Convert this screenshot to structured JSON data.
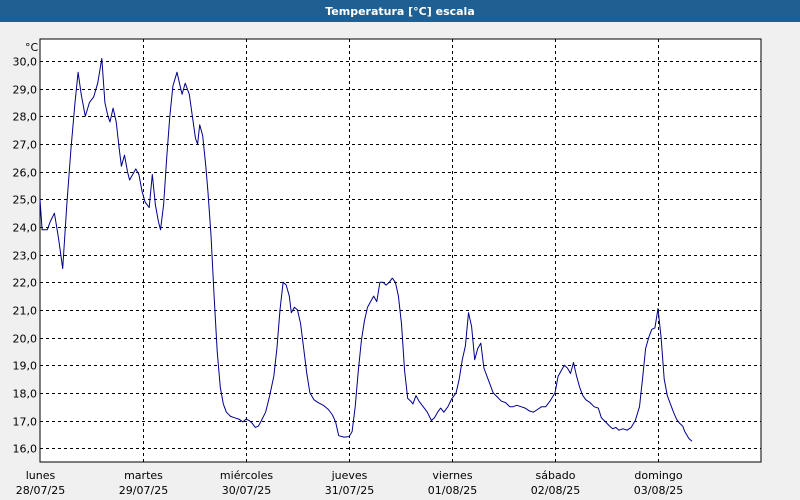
{
  "window": {
    "title": "Temperatura [°C] escala"
  },
  "colors": {
    "title_bar": "#1f5f91",
    "line": "#00008b",
    "grid": "#000000",
    "plot_bg": "#ffffff",
    "page_bg": "#f0f0f0"
  },
  "chart_data": {
    "type": "line",
    "title": "Temperatura [°C] escala",
    "ylabel": "°C",
    "xlabel": "",
    "ylim": [
      15.5,
      30.8
    ],
    "xlim": [
      0,
      7
    ],
    "yticks": [
      16,
      17,
      18,
      19,
      20,
      21,
      22,
      23,
      24,
      25,
      26,
      27,
      28,
      29,
      30
    ],
    "ytick_labels": [
      "16,0",
      "17,0",
      "18,0",
      "19,0",
      "20,0",
      "21,0",
      "22,0",
      "23,0",
      "24,0",
      "25,0",
      "26,0",
      "27,0",
      "28,0",
      "29,0",
      "30,0"
    ],
    "x_day_labels": [
      {
        "day": "lunes",
        "date": "28/07/25"
      },
      {
        "day": "martes",
        "date": "29/07/25"
      },
      {
        "day": "miércoles",
        "date": "30/07/25"
      },
      {
        "day": "jueves",
        "date": "31/07/25"
      },
      {
        "day": "viernes",
        "date": "01/08/25"
      },
      {
        "day": "sábado",
        "date": "02/08/25"
      },
      {
        "day": "domingo",
        "date": "03/08/25"
      }
    ],
    "grid": true,
    "series": [
      {
        "values": [
          [
            0.0,
            25.0
          ],
          [
            0.02,
            23.9
          ],
          [
            0.07,
            23.9
          ],
          [
            0.1,
            24.2
          ],
          [
            0.14,
            24.5
          ],
          [
            0.18,
            23.6
          ],
          [
            0.22,
            22.5
          ],
          [
            0.26,
            24.8
          ],
          [
            0.3,
            26.8
          ],
          [
            0.34,
            28.5
          ],
          [
            0.37,
            29.6
          ],
          [
            0.4,
            28.8
          ],
          [
            0.44,
            28.0
          ],
          [
            0.48,
            28.5
          ],
          [
            0.52,
            28.7
          ],
          [
            0.56,
            29.2
          ],
          [
            0.6,
            30.1
          ],
          [
            0.63,
            28.5
          ],
          [
            0.66,
            28.0
          ],
          [
            0.68,
            27.8
          ],
          [
            0.71,
            28.3
          ],
          [
            0.74,
            27.8
          ],
          [
            0.77,
            26.8
          ],
          [
            0.79,
            26.2
          ],
          [
            0.82,
            26.6
          ],
          [
            0.85,
            26.0
          ],
          [
            0.87,
            25.7
          ],
          [
            0.9,
            25.9
          ],
          [
            0.93,
            26.1
          ],
          [
            0.96,
            25.9
          ],
          [
            0.99,
            25.3
          ],
          [
            1.02,
            24.9
          ],
          [
            1.06,
            24.7
          ],
          [
            1.09,
            25.9
          ],
          [
            1.12,
            24.8
          ],
          [
            1.15,
            24.2
          ],
          [
            1.17,
            23.9
          ],
          [
            1.2,
            24.8
          ],
          [
            1.23,
            26.5
          ],
          [
            1.26,
            28.0
          ],
          [
            1.29,
            29.1
          ],
          [
            1.33,
            29.6
          ],
          [
            1.36,
            29.1
          ],
          [
            1.38,
            28.8
          ],
          [
            1.41,
            29.2
          ],
          [
            1.45,
            28.8
          ],
          [
            1.48,
            28.0
          ],
          [
            1.51,
            27.2
          ],
          [
            1.53,
            27.0
          ],
          [
            1.55,
            27.7
          ],
          [
            1.58,
            27.3
          ],
          [
            1.61,
            26.2
          ],
          [
            1.63,
            25.3
          ],
          [
            1.66,
            23.7
          ],
          [
            1.69,
            21.5
          ],
          [
            1.72,
            19.5
          ],
          [
            1.75,
            18.2
          ],
          [
            1.78,
            17.6
          ],
          [
            1.81,
            17.3
          ],
          [
            1.85,
            17.15
          ],
          [
            1.89,
            17.1
          ],
          [
            1.93,
            17.05
          ],
          [
            1.97,
            16.95
          ],
          [
            2.0,
            17.05
          ],
          [
            2.03,
            17.0
          ],
          [
            2.06,
            16.9
          ],
          [
            2.09,
            16.75
          ],
          [
            2.12,
            16.8
          ],
          [
            2.15,
            17.0
          ],
          [
            2.19,
            17.3
          ],
          [
            2.23,
            17.9
          ],
          [
            2.27,
            18.6
          ],
          [
            2.3,
            19.6
          ],
          [
            2.33,
            21.0
          ],
          [
            2.36,
            22.0
          ],
          [
            2.39,
            21.9
          ],
          [
            2.42,
            21.5
          ],
          [
            2.44,
            20.9
          ],
          [
            2.47,
            21.1
          ],
          [
            2.5,
            21.0
          ],
          [
            2.53,
            20.5
          ],
          [
            2.56,
            19.6
          ],
          [
            2.59,
            18.7
          ],
          [
            2.62,
            18.0
          ],
          [
            2.66,
            17.75
          ],
          [
            2.7,
            17.65
          ],
          [
            2.75,
            17.55
          ],
          [
            2.8,
            17.4
          ],
          [
            2.84,
            17.2
          ],
          [
            2.87,
            16.95
          ],
          [
            2.9,
            16.45
          ],
          [
            2.95,
            16.4
          ],
          [
            3.0,
            16.42
          ],
          [
            3.03,
            16.6
          ],
          [
            3.06,
            17.5
          ],
          [
            3.09,
            18.8
          ],
          [
            3.12,
            19.9
          ],
          [
            3.15,
            20.6
          ],
          [
            3.18,
            21.1
          ],
          [
            3.21,
            21.3
          ],
          [
            3.24,
            21.5
          ],
          [
            3.27,
            21.3
          ],
          [
            3.3,
            22.0
          ],
          [
            3.33,
            22.0
          ],
          [
            3.36,
            21.9
          ],
          [
            3.39,
            22.0
          ],
          [
            3.42,
            22.15
          ],
          [
            3.45,
            22.0
          ],
          [
            3.48,
            21.5
          ],
          [
            3.51,
            20.5
          ],
          [
            3.54,
            18.8
          ],
          [
            3.57,
            17.8
          ],
          [
            3.6,
            17.7
          ],
          [
            3.62,
            17.6
          ],
          [
            3.65,
            17.9
          ],
          [
            3.68,
            17.7
          ],
          [
            3.72,
            17.5
          ],
          [
            3.76,
            17.3
          ],
          [
            3.8,
            17.0
          ],
          [
            3.83,
            17.1
          ],
          [
            3.86,
            17.3
          ],
          [
            3.89,
            17.45
          ],
          [
            3.92,
            17.3
          ],
          [
            3.96,
            17.5
          ],
          [
            4.0,
            17.8
          ],
          [
            4.04,
            18.0
          ],
          [
            4.07,
            18.5
          ],
          [
            4.1,
            19.2
          ],
          [
            4.13,
            19.7
          ],
          [
            4.16,
            20.9
          ],
          [
            4.19,
            20.4
          ],
          [
            4.22,
            19.2
          ],
          [
            4.25,
            19.6
          ],
          [
            4.28,
            19.8
          ],
          [
            4.31,
            18.9
          ],
          [
            4.34,
            18.6
          ],
          [
            4.37,
            18.3
          ],
          [
            4.4,
            18.0
          ],
          [
            4.44,
            17.85
          ],
          [
            4.48,
            17.7
          ],
          [
            4.52,
            17.65
          ],
          [
            4.56,
            17.5
          ],
          [
            4.59,
            17.5
          ],
          [
            4.63,
            17.55
          ],
          [
            4.67,
            17.5
          ],
          [
            4.71,
            17.45
          ],
          [
            4.75,
            17.35
          ],
          [
            4.79,
            17.3
          ],
          [
            4.83,
            17.4
          ],
          [
            4.87,
            17.5
          ],
          [
            4.91,
            17.5
          ],
          [
            4.95,
            17.7
          ],
          [
            5.0,
            18.0
          ],
          [
            5.03,
            18.6
          ],
          [
            5.06,
            18.8
          ],
          [
            5.09,
            19.0
          ],
          [
            5.12,
            18.9
          ],
          [
            5.15,
            18.7
          ],
          [
            5.18,
            19.1
          ],
          [
            5.21,
            18.6
          ],
          [
            5.24,
            18.2
          ],
          [
            5.27,
            17.9
          ],
          [
            5.3,
            17.75
          ],
          [
            5.34,
            17.65
          ],
          [
            5.38,
            17.5
          ],
          [
            5.42,
            17.45
          ],
          [
            5.45,
            17.1
          ],
          [
            5.49,
            16.95
          ],
          [
            5.53,
            16.8
          ],
          [
            5.56,
            16.7
          ],
          [
            5.59,
            16.75
          ],
          [
            5.62,
            16.65
          ],
          [
            5.66,
            16.7
          ],
          [
            5.7,
            16.65
          ],
          [
            5.74,
            16.75
          ],
          [
            5.78,
            17.0
          ],
          [
            5.82,
            17.5
          ],
          [
            5.85,
            18.5
          ],
          [
            5.88,
            19.6
          ],
          [
            5.91,
            20.0
          ],
          [
            5.94,
            20.3
          ],
          [
            5.97,
            20.35
          ],
          [
            6.0,
            21.05
          ],
          [
            6.03,
            20.0
          ],
          [
            6.06,
            18.5
          ],
          [
            6.09,
            17.9
          ],
          [
            6.12,
            17.6
          ],
          [
            6.15,
            17.3
          ],
          [
            6.18,
            17.05
          ],
          [
            6.21,
            16.9
          ],
          [
            6.24,
            16.8
          ],
          [
            6.26,
            16.6
          ],
          [
            6.3,
            16.35
          ],
          [
            6.33,
            16.25
          ]
        ]
      }
    ]
  }
}
